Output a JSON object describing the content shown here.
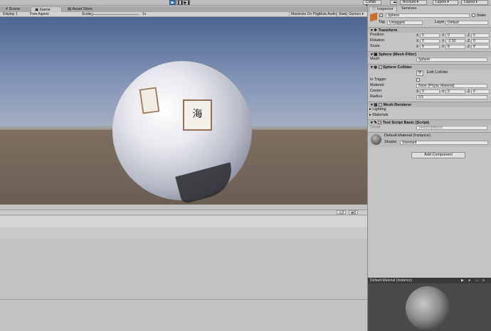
{
  "toolbar": {
    "play": "▶",
    "pause": "❚❚",
    "step": "▶❚",
    "collab": "Collab ▾",
    "cloud": "☁",
    "account": "Account ▾",
    "layers": "Layers ▾",
    "layout": "Layout ▾"
  },
  "tabs": {
    "scene": "Scene",
    "game": "Game",
    "asset_store": "Asset Store"
  },
  "game_bar": {
    "display": "Display 1",
    "aspect": "Free Aspect",
    "scale_label": "Scale",
    "scale_value": "1x",
    "maximize": "Maximize On Play",
    "mute": "Mute Audio",
    "stats": "Stats",
    "gizmos": "Gizmos ▾"
  },
  "viewport": {
    "calligraphy_glyph": "海"
  },
  "console": {
    "warn_count": "2",
    "error_count": "0"
  },
  "inspector": {
    "tab_inspector": "Inspector",
    "tab_services": "Services",
    "object_name": "Sphere",
    "static_label": "Static",
    "tag_label": "Tag",
    "tag_value": "Untagged",
    "layer_label": "Layer",
    "layer_value": "Default",
    "transform": {
      "title": "Transform",
      "position_label": "Position",
      "rotation_label": "Rotation",
      "scale_label": "Scale",
      "position": [
        "0",
        "0",
        "0"
      ],
      "rotation": [
        "0",
        "-2.93",
        "0"
      ],
      "scale": [
        "8",
        "8",
        "8"
      ]
    },
    "mesh_filter": {
      "title": "Sphere (Mesh Filter)",
      "mesh_label": "Mesh",
      "mesh_value": "Sphere"
    },
    "sphere_collider": {
      "title": "Sphere Collider",
      "edit_label": "Edit Collider",
      "is_trigger_label": "Is Trigger",
      "material_label": "Material",
      "material_value": "None (Physic Material)",
      "center_label": "Center",
      "center": [
        "0",
        "0",
        "0"
      ],
      "radius_label": "Radius",
      "radius_value": "0.5"
    },
    "mesh_renderer": {
      "title": "Mesh Renderer",
      "lighting": "Lighting",
      "materials": "Materials"
    },
    "script": {
      "title": "Test Script Basic (Script)",
      "script_label": "Script",
      "script_value": "TestScriptBasic"
    },
    "material": {
      "name": "Default-Material (Instance)",
      "shader_label": "Shader",
      "shader_value": "Standard"
    },
    "add_component": "Add Component",
    "preview_title": "Default-Material (Instance)"
  },
  "colors": {
    "accent": "#3d7ec9",
    "sky": "#5a6f96",
    "ground": "#6f6256"
  }
}
